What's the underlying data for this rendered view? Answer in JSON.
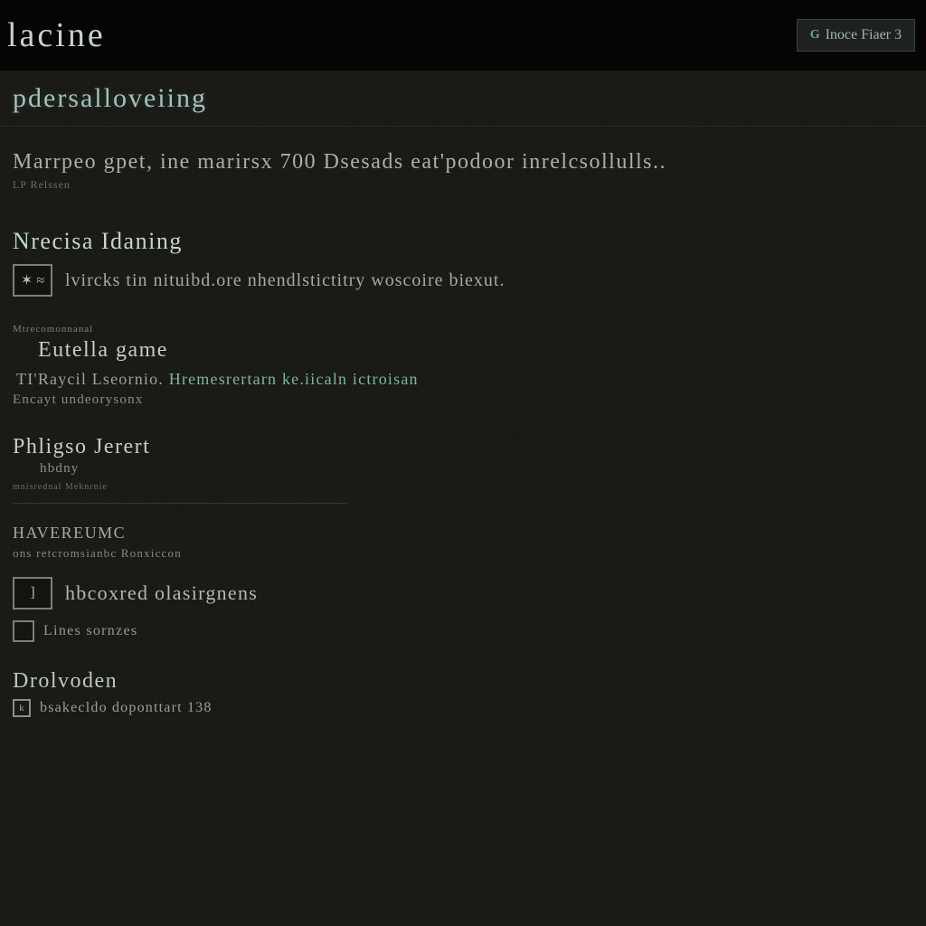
{
  "topbar": {
    "title": "lacine",
    "button_leading": "G",
    "button_label": "Inoce Fiaer 3"
  },
  "subheader": "pdersalloveiing",
  "intro": {
    "text": "Marrpeo gpet, ine marirsx 700 Dsesads eat'podoor inrelcsollulls..",
    "sub": "LP Relssen"
  },
  "section1": {
    "title": "Nrecisa Idaning",
    "checkbox_mark": "✶ ≈",
    "text": "lvircks tin nituibd.ore nhendlstictitry woscoire biexut."
  },
  "section2": {
    "super": "Mtrecomonnanal",
    "subtitle": "Eutella game",
    "line1_prefix": "TI'Raycil Lseornio.",
    "line1_accent": "Hremesrertarn ke.iicaln ictroisan",
    "line2": "Encayt undeorysonx"
  },
  "section3": {
    "title": "Phligso Jerert",
    "sub": "hbdny",
    "tiny": "mnisrednal Meknrnie"
  },
  "section4": {
    "title": "HAVEREUMC",
    "sub": "ons retcromsianbc Ronxiccon",
    "row1_mark": "]",
    "row1_text": "hbcoxred olasirgnens",
    "row2_text": "Lines sornzes"
  },
  "section5": {
    "title": "Drolvoden",
    "line_text": "bsakecldo doponttart 138"
  }
}
